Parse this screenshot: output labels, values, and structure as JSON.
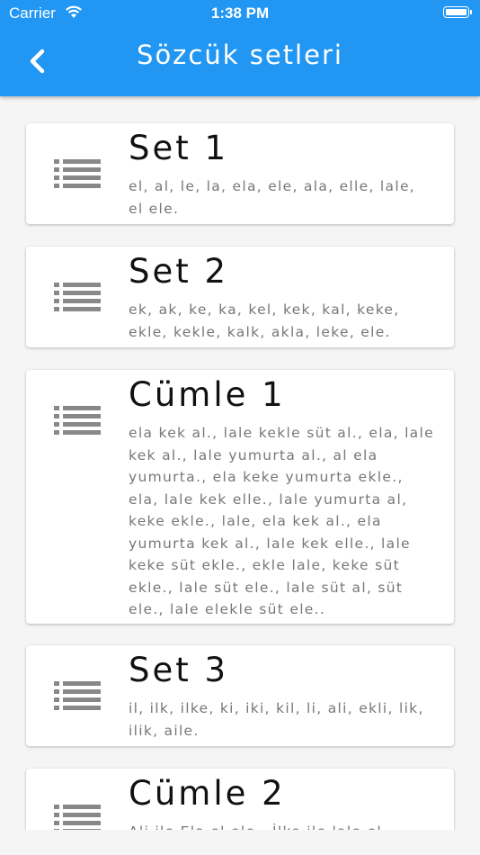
{
  "status_bar": {
    "carrier": "Carrier",
    "time": "1:38 PM"
  },
  "header": {
    "title": "Sözcük setleri",
    "back_icon": "chevron-left-icon",
    "color": "#2196f3"
  },
  "sets": [
    {
      "name": "Set 1",
      "icon": "list-icon",
      "words": "el, al, le, la, ela, ele, ala, elle, lale, el ele."
    },
    {
      "name": "Set 2",
      "icon": "list-icon",
      "words": "ek, ak, ke, ka, kel, kek, kal, keke, ekle, kekle, kalk, akla, leke, ele."
    },
    {
      "name": "Cümle 1",
      "icon": "list-icon",
      "words": "ela kek al., lale kekle süt al., ela, lale kek al., lale yumurta al., al ela yumurta., ela keke yumurta ekle., ela, lale kek elle., lale yumurta al, keke ekle., lale, ela kek al., ela yumurta kek al., lale kek elle., lale keke süt ekle., ekle lale, keke süt ekle., lale süt ele., lale süt al, süt ele., lale elekle süt ele.."
    },
    {
      "name": "Set 3",
      "icon": "list-icon",
      "words": "il, ilk, ilke, ki, iki, kil, li, ali, ekli, lik, ilik, aile."
    },
    {
      "name": "Cümle 2",
      "icon": "list-icon",
      "words": "Ali ile Ela el ele.. İlke ile lale el"
    }
  ]
}
